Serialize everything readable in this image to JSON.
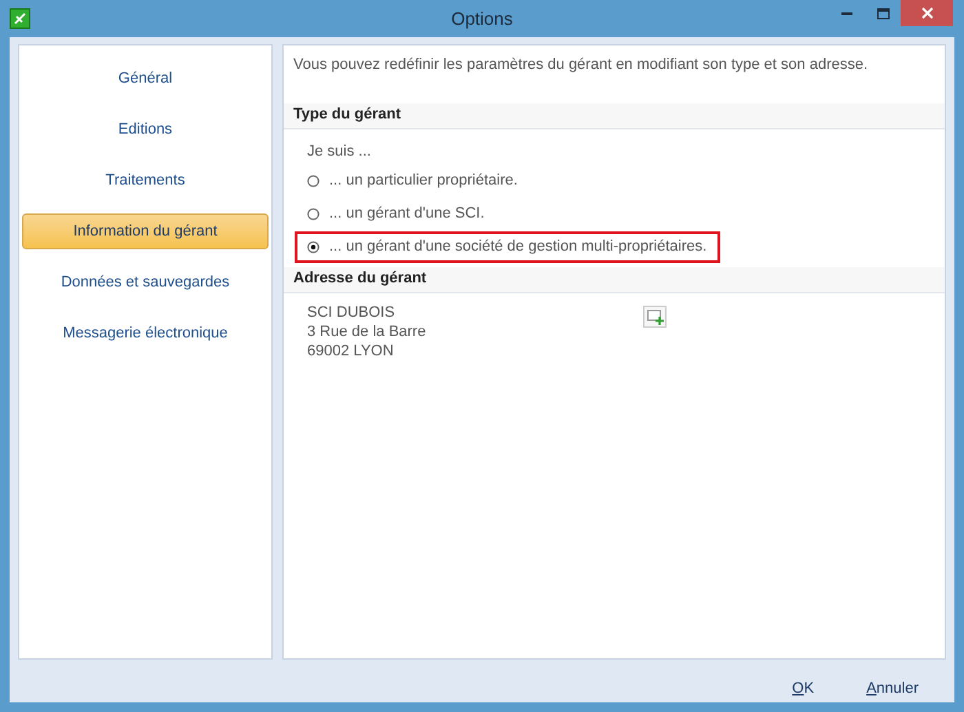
{
  "window": {
    "title": "Options"
  },
  "sidebar": {
    "items": [
      {
        "label": "Général",
        "selected": false
      },
      {
        "label": "Editions",
        "selected": false
      },
      {
        "label": "Traitements",
        "selected": false
      },
      {
        "label": "Information du gérant",
        "selected": true
      },
      {
        "label": "Données et sauvegardes",
        "selected": false
      },
      {
        "label": "Messagerie électronique",
        "selected": false
      }
    ]
  },
  "intro": "Vous pouvez redéfinir les paramètres du gérant en modifiant son type et son adresse.",
  "type_section": {
    "title": "Type du gérant",
    "prompt": "Je suis ...",
    "options": [
      {
        "label": "... un particulier propriétaire.",
        "selected": false
      },
      {
        "label": "... un gérant d'une SCI.",
        "selected": false
      },
      {
        "label": "... un gérant d'une société de gestion multi-propriétaires.",
        "selected": true
      }
    ]
  },
  "address_section": {
    "title": "Adresse du gérant",
    "lines": [
      "SCI DUBOIS",
      "3 Rue de la Barre",
      "69002 LYON"
    ]
  },
  "buttons": [
    "OK",
    "Annuler"
  ]
}
